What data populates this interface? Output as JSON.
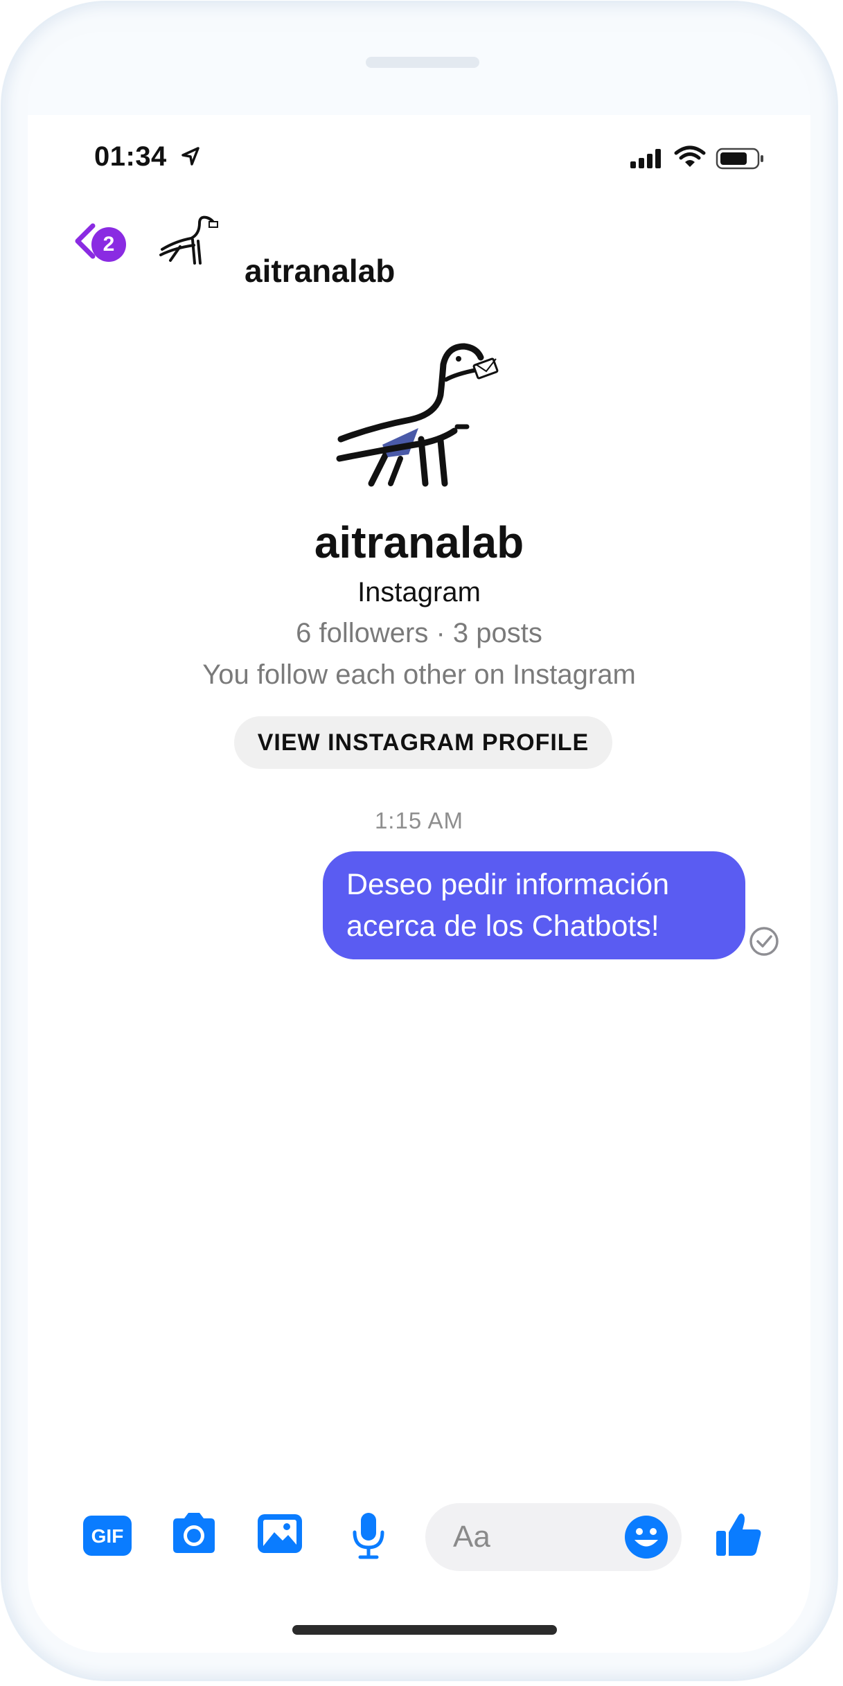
{
  "status_bar": {
    "time": "01:34",
    "icons": [
      "location-arrow-icon",
      "signal-icon",
      "wifi-icon",
      "battery-icon"
    ]
  },
  "header": {
    "back_badge_count": "2",
    "title": "aitranalab",
    "accent_color": "#8a2be2"
  },
  "profile": {
    "name": "aitranalab",
    "source": "Instagram",
    "stats": "6 followers · 3 posts",
    "follow_status": "You follow each other on Instagram",
    "view_button_label": "VIEW INSTAGRAM PROFILE"
  },
  "conversation": {
    "timestamp": "1:15 AM",
    "messages": [
      {
        "sender": "me",
        "lines": [
          "Deseo pedir información",
          "acerca de los Chatbots!"
        ],
        "status": "sent",
        "bubble_color": "#5a5cf2"
      }
    ]
  },
  "composer": {
    "placeholder": "Aa",
    "gif_label": "GIF",
    "icon_color": "#0a7cff",
    "tools": [
      "gif-icon",
      "camera-icon",
      "image-icon",
      "microphone-icon",
      "emoji-icon",
      "thumbs-up-icon"
    ]
  }
}
